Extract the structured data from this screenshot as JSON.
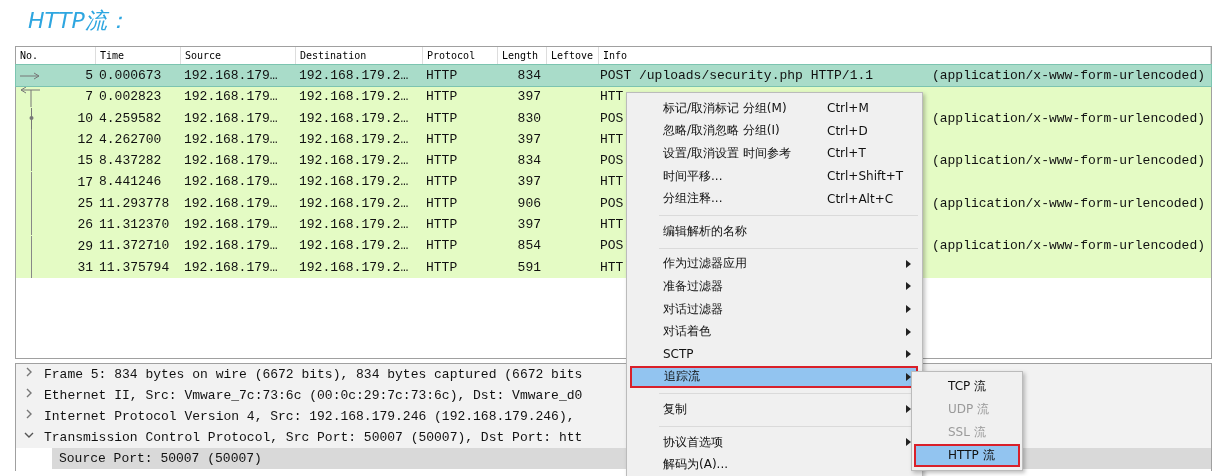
{
  "heading": "HTTP流：",
  "packet_list": {
    "columns": [
      "No.",
      "Time",
      "Source",
      "Destination",
      "Protocol",
      "Length",
      "Leftove",
      "Info"
    ],
    "rows": [
      {
        "no": "5",
        "time": "0.000673",
        "source": "192.168.179…",
        "destination": "192.168.179.2…",
        "protocol": "HTTP",
        "length": "834",
        "info": "POST /uploads/security.php HTTP/1.1",
        "info_end": "(application/x-www-form-urlencoded)",
        "selected": true,
        "kind": "request"
      },
      {
        "no": "7",
        "time": "0.002823",
        "source": "192.168.179…",
        "destination": "192.168.179.2…",
        "protocol": "HTTP",
        "length": "397",
        "info": "HTT",
        "selected": false,
        "kind": "response"
      },
      {
        "no": "10",
        "time": "4.259582",
        "source": "192.168.179…",
        "destination": "192.168.179.2…",
        "protocol": "HTTP",
        "length": "830",
        "info": "POS",
        "info_end": "(application/x-www-form-urlencoded)",
        "selected": false,
        "kind": "related"
      },
      {
        "no": "12",
        "time": "4.262700",
        "source": "192.168.179…",
        "destination": "192.168.179.2…",
        "protocol": "HTTP",
        "length": "397",
        "info": "HTT",
        "selected": false,
        "kind": "plain"
      },
      {
        "no": "15",
        "time": "8.437282",
        "source": "192.168.179…",
        "destination": "192.168.179.2…",
        "protocol": "HTTP",
        "length": "834",
        "info": "POS",
        "info_end": "(application/x-www-form-urlencoded)",
        "selected": false,
        "kind": "plain"
      },
      {
        "no": "17",
        "time": "8.441246",
        "source": "192.168.179…",
        "destination": "192.168.179.2…",
        "protocol": "HTTP",
        "length": "397",
        "info": "HTT",
        "selected": false,
        "kind": "plain"
      },
      {
        "no": "25",
        "time": "11.293778",
        "source": "192.168.179…",
        "destination": "192.168.179.2…",
        "protocol": "HTTP",
        "length": "906",
        "info": "POS",
        "info_end": "(application/x-www-form-urlencoded)",
        "selected": false,
        "kind": "plain"
      },
      {
        "no": "26",
        "time": "11.312370",
        "source": "192.168.179…",
        "destination": "192.168.179.2…",
        "protocol": "HTTP",
        "length": "397",
        "info": "HTT",
        "selected": false,
        "kind": "plain"
      },
      {
        "no": "29",
        "time": "11.372710",
        "source": "192.168.179…",
        "destination": "192.168.179.2…",
        "protocol": "HTTP",
        "length": "854",
        "info": "POS",
        "info_end": "(application/x-www-form-urlencoded)",
        "selected": false,
        "kind": "plain"
      },
      {
        "no": "31",
        "time": "11.375794",
        "source": "192.168.179…",
        "destination": "192.168.179.2…",
        "protocol": "HTTP",
        "length": "591",
        "info": "HTT",
        "selected": false,
        "kind": "plain"
      }
    ]
  },
  "details": [
    {
      "text": "Frame 5: 834 bytes on wire (6672 bits), 834 bytes captured (6672 bits",
      "expanded": false,
      "selected": false
    },
    {
      "text": "Ethernet II, Src: Vmware_7c:73:6c (00:0c:29:7c:73:6c), Dst: Vmware_d0",
      "expanded": false,
      "selected": false
    },
    {
      "text": "Internet Protocol Version 4, Src: 192.168.179.246 (192.168.179.246),",
      "expanded": false,
      "selected": false
    },
    {
      "text": "Transmission Control Protocol, Src Port: 50007 (50007), Dst Port: htt",
      "expanded": true,
      "selected": false,
      "children": [
        {
          "text": "Source Port: 50007 (50007)",
          "selected": true
        }
      ]
    }
  ],
  "context_menu": [
    {
      "kind": "item",
      "label": "标记/取消标记 分组(M)",
      "shortcut": "Ctrl+M",
      "submenu": false,
      "highlighted": false
    },
    {
      "kind": "item",
      "label": "忽略/取消忽略 分组(I)",
      "shortcut": "Ctrl+D",
      "submenu": false,
      "highlighted": false
    },
    {
      "kind": "item",
      "label": "设置/取消设置 时间参考",
      "shortcut": "Ctrl+T",
      "submenu": false,
      "highlighted": false
    },
    {
      "kind": "item",
      "label": "时间平移...",
      "shortcut": "Ctrl+Shift+T",
      "submenu": false,
      "highlighted": false
    },
    {
      "kind": "item",
      "label": "分组注释...",
      "shortcut": "Ctrl+Alt+C",
      "submenu": false,
      "highlighted": false
    },
    {
      "kind": "separator"
    },
    {
      "kind": "item",
      "label": "编辑解析的名称",
      "submenu": false,
      "highlighted": false
    },
    {
      "kind": "separator"
    },
    {
      "kind": "item",
      "label": "作为过滤器应用",
      "submenu": true,
      "highlighted": false
    },
    {
      "kind": "item",
      "label": "准备过滤器",
      "submenu": true,
      "highlighted": false
    },
    {
      "kind": "item",
      "label": "对话过滤器",
      "submenu": true,
      "highlighted": false
    },
    {
      "kind": "item",
      "label": "对话着色",
      "submenu": true,
      "highlighted": false
    },
    {
      "kind": "item",
      "label": "SCTP",
      "submenu": true,
      "highlighted": false
    },
    {
      "kind": "item",
      "label": "追踪流",
      "submenu": true,
      "highlighted": true
    },
    {
      "kind": "separator"
    },
    {
      "kind": "item",
      "label": "复制",
      "submenu": true,
      "highlighted": false
    },
    {
      "kind": "separator"
    },
    {
      "kind": "item",
      "label": "协议首选项",
      "submenu": true,
      "highlighted": false
    },
    {
      "kind": "item",
      "label": "解码为(A)...",
      "submenu": false,
      "highlighted": false
    }
  ],
  "submenu": [
    {
      "label": "TCP 流",
      "disabled": false,
      "highlighted": false
    },
    {
      "label": "UDP 流",
      "disabled": true,
      "highlighted": false
    },
    {
      "label": "SSL 流",
      "disabled": true,
      "highlighted": false
    },
    {
      "label": "HTTP 流",
      "disabled": false,
      "highlighted": true
    }
  ]
}
